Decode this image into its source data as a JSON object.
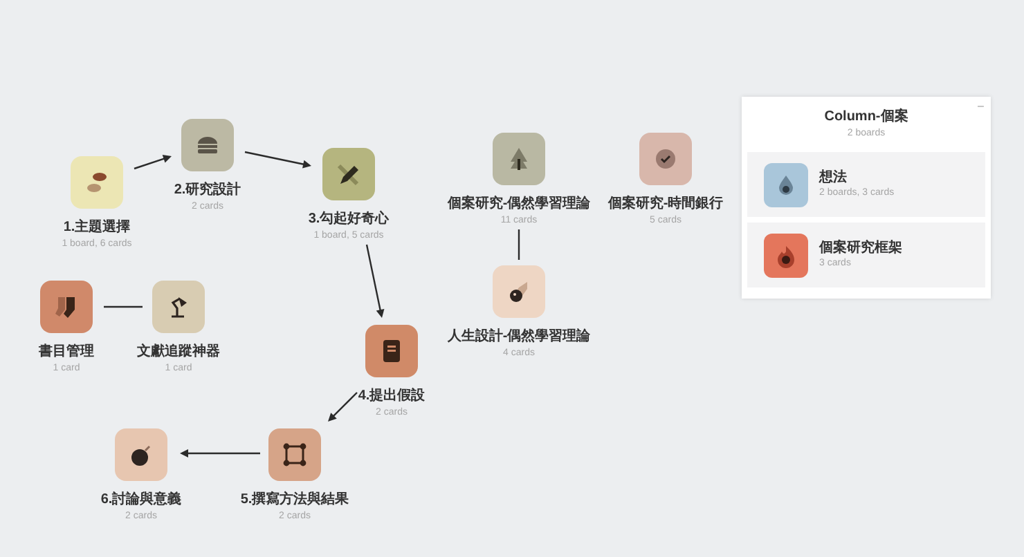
{
  "canvas": {
    "nodes": [
      {
        "title": "1.主題選擇",
        "subtitle": "1 board, 6 cards",
        "color": "#ece6b4"
      },
      {
        "title": "2.研究設計",
        "subtitle": "2 cards",
        "color": "#bcb9a4"
      },
      {
        "title": "3.勾起好奇心",
        "subtitle": "1 board, 5 cards",
        "color": "#b5b57f"
      },
      {
        "title": "4.提出假設",
        "subtitle": "2 cards",
        "color": "#d08a68"
      },
      {
        "title": "6.討論與意義",
        "subtitle": "2 cards",
        "color": "#e7c6b0"
      },
      {
        "title": "5.撰寫方法與結果",
        "subtitle": "2 cards",
        "color": "#d6a488"
      },
      {
        "title": "書目管理",
        "subtitle": "1 card",
        "color": "#d0896a"
      },
      {
        "title": "文獻追蹤神器",
        "subtitle": "1 card",
        "color": "#d8ccb2"
      },
      {
        "title": "個案研究-偶然學習理論",
        "subtitle": "11 cards",
        "color": "#b9b8a3"
      },
      {
        "title": "個案研究-時間銀行",
        "subtitle": "5 cards",
        "color": "#d8b7ab"
      },
      {
        "title": "人生設計-偶然學習理論",
        "subtitle": "4 cards",
        "color": "#eed6c4"
      }
    ]
  },
  "column_panel": {
    "title": "Column-個案",
    "subtitle": "2 boards",
    "minimize": "–",
    "items": [
      {
        "title": "想法",
        "subtitle": "2 boards, 3 cards",
        "color": "#a9c6da"
      },
      {
        "title": "個案研究框架",
        "subtitle": "3 cards",
        "color": "#e4765c"
      }
    ]
  }
}
